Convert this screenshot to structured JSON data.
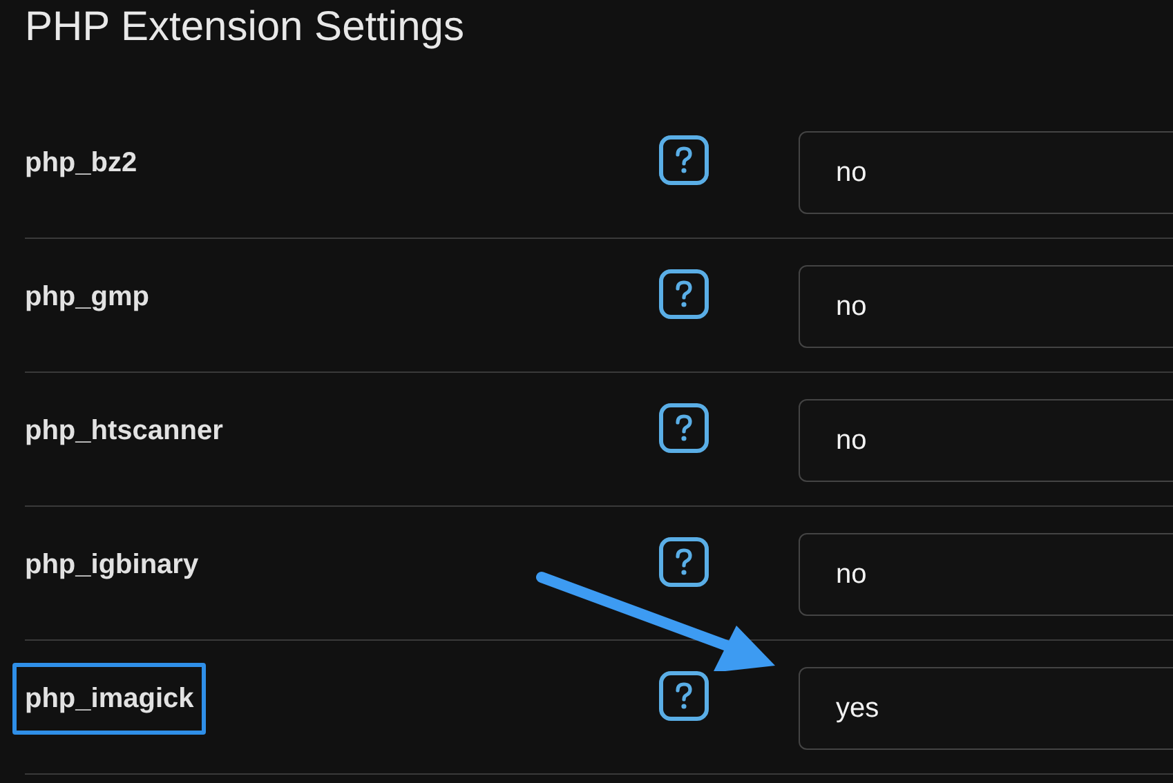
{
  "title": "PHP Extension Settings",
  "settings": [
    {
      "name": "php_bz2",
      "value": "no",
      "highlighted": false
    },
    {
      "name": "php_gmp",
      "value": "no",
      "highlighted": false
    },
    {
      "name": "php_htscanner",
      "value": "no",
      "highlighted": false
    },
    {
      "name": "php_igbinary",
      "value": "no",
      "highlighted": false
    },
    {
      "name": "php_imagick",
      "value": "yes",
      "highlighted": true
    }
  ]
}
